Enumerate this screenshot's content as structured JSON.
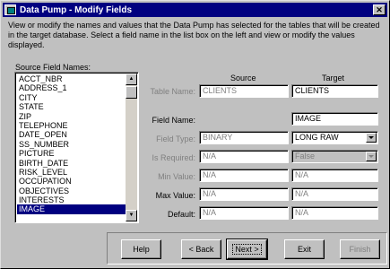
{
  "window": {
    "title": "Data Pump - Modify Fields"
  },
  "intro_text": "View or modify the names and values that the Data Pump has selected for the tables that will be created in the target database. Select a field name in the list box on the left and view or modify the values displayed.",
  "source_fields": {
    "label": "Source Field Names:",
    "items": [
      "ACCT_NBR",
      "ADDRESS_1",
      "CITY",
      "STATE",
      "ZIP",
      "TELEPHONE",
      "DATE_OPEN",
      "SS_NUMBER",
      "PICTURE",
      "BIRTH_DATE",
      "RISK_LEVEL",
      "OCCUPATION",
      "OBJECTIVES",
      "INTERESTS",
      "IMAGE"
    ],
    "selected_index": 14
  },
  "columns": {
    "source": "Source",
    "target": "Target"
  },
  "form": {
    "table_name": {
      "label": "Table Name:",
      "source": "CLIENTS",
      "target": "CLIENTS"
    },
    "field_name": {
      "label": "Field Name:",
      "target": "IMAGE"
    },
    "field_type": {
      "label": "Field Type:",
      "source": "BINARY",
      "target": "LONG RAW"
    },
    "is_required": {
      "label": "Is Required:",
      "source": "N/A",
      "target": "False"
    },
    "min_value": {
      "label": "Min Value:",
      "source": "N/A",
      "target": "N/A"
    },
    "max_value": {
      "label": "Max Value:",
      "source": "N/A",
      "target": "N/A"
    },
    "default": {
      "label": "Default:",
      "source": "N/A",
      "target": "N/A"
    }
  },
  "buttons": {
    "help": "Help",
    "back": "< Back",
    "next": "Next >",
    "exit": "Exit",
    "finish": "Finish"
  },
  "colors": {
    "title_bar": "#000080",
    "face": "#c0c0c0",
    "selection": "#000080"
  }
}
